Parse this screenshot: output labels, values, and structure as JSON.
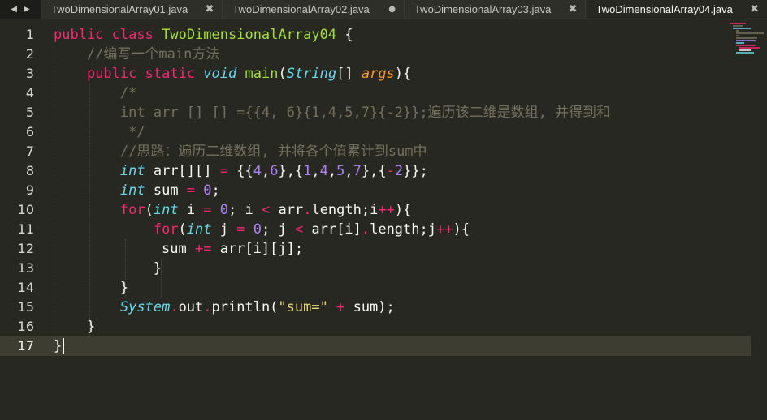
{
  "tabs": {
    "nav_prev": "◀",
    "nav_next": "▶",
    "items": [
      {
        "label": "TwoDimensionalArray01.java",
        "state": "close"
      },
      {
        "label": "TwoDimensionalArray02.java",
        "state": "dirty"
      },
      {
        "label": "TwoDimensionalArray03.java",
        "state": "close"
      },
      {
        "label": "TwoDimensionalArray04.java",
        "state": "active"
      }
    ],
    "close_glyph": "✖",
    "dirty_glyph": "●"
  },
  "editor": {
    "current_line": 17,
    "line_numbers": [
      "1",
      "2",
      "3",
      "4",
      "5",
      "6",
      "7",
      "8",
      "9",
      "10",
      "11",
      "12",
      "13",
      "14",
      "15",
      "16",
      "17"
    ],
    "lines": [
      [
        [
          "kw",
          "public"
        ],
        [
          "t",
          " "
        ],
        [
          "kw",
          "class"
        ],
        [
          "t",
          " "
        ],
        [
          "cls",
          "TwoDimensionalArray04"
        ],
        [
          "t",
          " {"
        ]
      ],
      [
        [
          "t",
          "    "
        ],
        [
          "cm",
          "//编写一个main方法"
        ]
      ],
      [
        [
          "t",
          "    "
        ],
        [
          "kw",
          "public"
        ],
        [
          "t",
          " "
        ],
        [
          "kw",
          "static"
        ],
        [
          "t",
          " "
        ],
        [
          "ty",
          "void"
        ],
        [
          "t",
          " "
        ],
        [
          "fn",
          "main"
        ],
        [
          "t",
          "("
        ],
        [
          "ty",
          "String"
        ],
        [
          "t",
          "[] "
        ],
        [
          "par",
          "args"
        ],
        [
          "t",
          "){"
        ]
      ],
      [
        [
          "t",
          "        "
        ],
        [
          "cm",
          "/*"
        ]
      ],
      [
        [
          "t",
          "        "
        ],
        [
          "cm",
          "int arr [] [] ={{4, 6}{1,4,5,7}{-2}};遍历该二维是数组, 并得到和"
        ]
      ],
      [
        [
          "t",
          "         "
        ],
        [
          "cm",
          "*/"
        ]
      ],
      [
        [
          "t",
          "        "
        ],
        [
          "cm",
          "//思路：遍历二维数组, 并将各个值累计到sum中"
        ]
      ],
      [
        [
          "t",
          "        "
        ],
        [
          "ty",
          "int"
        ],
        [
          "t",
          " arr[][] "
        ],
        [
          "op",
          "="
        ],
        [
          "t",
          " {{"
        ],
        [
          "num",
          "4"
        ],
        [
          "t",
          ","
        ],
        [
          "num",
          "6"
        ],
        [
          "t",
          "},{"
        ],
        [
          "num",
          "1"
        ],
        [
          "t",
          ","
        ],
        [
          "num",
          "4"
        ],
        [
          "t",
          ","
        ],
        [
          "num",
          "5"
        ],
        [
          "t",
          ","
        ],
        [
          "num",
          "7"
        ],
        [
          "t",
          "},{"
        ],
        [
          "op",
          "-"
        ],
        [
          "num",
          "2"
        ],
        [
          "t",
          "}};"
        ]
      ],
      [
        [
          "t",
          "        "
        ],
        [
          "ty",
          "int"
        ],
        [
          "t",
          " sum "
        ],
        [
          "op",
          "="
        ],
        [
          "t",
          " "
        ],
        [
          "num",
          "0"
        ],
        [
          "t",
          ";"
        ]
      ],
      [
        [
          "t",
          "        "
        ],
        [
          "kw",
          "for"
        ],
        [
          "t",
          "("
        ],
        [
          "ty",
          "int"
        ],
        [
          "t",
          " i "
        ],
        [
          "op",
          "="
        ],
        [
          "t",
          " "
        ],
        [
          "num",
          "0"
        ],
        [
          "t",
          "; i "
        ],
        [
          "op",
          "<"
        ],
        [
          "t",
          " arr"
        ],
        [
          "op",
          "."
        ],
        [
          "t",
          "length;i"
        ],
        [
          "op",
          "++"
        ],
        [
          "t",
          "){"
        ]
      ],
      [
        [
          "t",
          "            "
        ],
        [
          "kw",
          "for"
        ],
        [
          "t",
          "("
        ],
        [
          "ty",
          "int"
        ],
        [
          "t",
          " j "
        ],
        [
          "op",
          "="
        ],
        [
          "t",
          " "
        ],
        [
          "num",
          "0"
        ],
        [
          "t",
          "; j "
        ],
        [
          "op",
          "<"
        ],
        [
          "t",
          " arr[i]"
        ],
        [
          "op",
          "."
        ],
        [
          "t",
          "length;j"
        ],
        [
          "op",
          "++"
        ],
        [
          "t",
          "){"
        ]
      ],
      [
        [
          "t",
          "             sum "
        ],
        [
          "op",
          "+="
        ],
        [
          "t",
          " arr[i][j];"
        ]
      ],
      [
        [
          "t",
          "            }"
        ]
      ],
      [
        [
          "t",
          "        }"
        ]
      ],
      [
        [
          "t",
          "        "
        ],
        [
          "ty",
          "System"
        ],
        [
          "op",
          "."
        ],
        [
          "t",
          "out"
        ],
        [
          "op",
          "."
        ],
        [
          "t",
          "println("
        ],
        [
          "str",
          "\"sum=\""
        ],
        [
          "t",
          " "
        ],
        [
          "op",
          "+"
        ],
        [
          "t",
          " sum);"
        ]
      ],
      [
        [
          "t",
          "    }"
        ]
      ],
      [
        [
          "t",
          "}"
        ]
      ]
    ]
  },
  "colors": {
    "background": "#272822",
    "keyword": "#f92672",
    "type": "#66d9ef",
    "function": "#a6e22e",
    "number": "#ae81ff",
    "string": "#e6db74",
    "comment": "#75715e",
    "parameter": "#fd971f"
  }
}
